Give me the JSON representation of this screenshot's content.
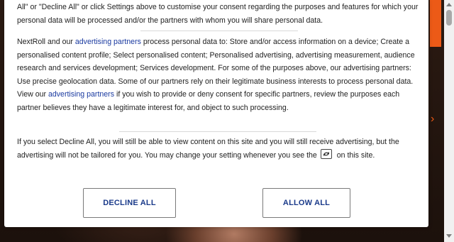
{
  "consent": {
    "intro": {
      "text": "All\" or \"Decline All\" or click Settings above to customise your consent regarding the purposes and features for which your personal data will be processed and/or the partners with whom you will share personal data."
    },
    "vendors": {
      "part1": "NextRoll and our ",
      "link1": "advertising partners",
      "part2": " process personal data to:    Store and/or access information on a device;    Create a personalised content profile;    Select personalised content;    Personalised advertising, advertising measurement, audience research and services development;    Services development. For some of the purposes above, our advertising partners:    Use precise geolocation data. Some of our partners rely on their legitimate business interests to process personal data. View our ",
      "link2": "advertising partners",
      "part3": " if you wish to provide or deny consent for specific partners, review the purposes each partner believes they have a legitimate interest for, and object to such processing."
    },
    "decline_info": {
      "part1": "If you select Decline All, you will still be able to view content on this site and you will still receive advertising, but the advertising will not be tailored for you. You may change your setting whenever you see the",
      "part2": "on this site."
    },
    "buttons": {
      "decline_label": "DECLINE ALL",
      "allow_label": "ALLOW ALL"
    }
  },
  "colors": {
    "accent_orange": "#ec5a17",
    "link_blue": "#1a3aa0",
    "button_text": "#1a3a8a"
  },
  "icons": {
    "settings_badge": "cookie-settings-icon",
    "side_arrow": "chevron-right-icon"
  }
}
